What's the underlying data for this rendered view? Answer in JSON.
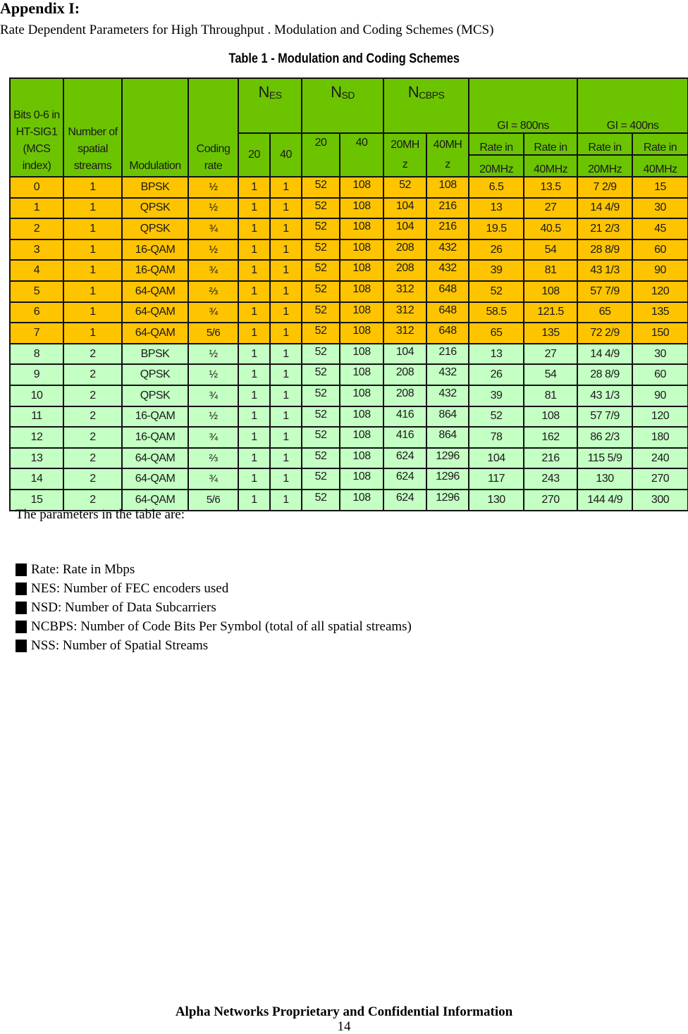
{
  "document": {
    "appendix_title": "Appendix I:",
    "subtitle": "Rate Dependent Parameters for High Throughput . Modulation and Coding Schemes (MCS)",
    "table_caption": "Table 1 - Modulation and Coding Schemes"
  },
  "colors": {
    "header_green": "#6cc400",
    "one_stream_orange": "#ffc400",
    "two_stream_green": "#c4ffc4"
  },
  "table": {
    "headers": {
      "mcs_index": "Bits 0-6 in HT-SIG1 (MCS index)",
      "spatial_streams": "Number of spatial streams",
      "modulation": "Modulation",
      "coding_rate": "Coding rate",
      "nes": {
        "base": "N",
        "sub": "ES",
        "col20": "20",
        "col40": "40"
      },
      "nsd": {
        "base": "N",
        "sub": "SD",
        "col20": "20",
        "col40": "40"
      },
      "ncbps": {
        "base": "N",
        "sub": "CBPS",
        "col20": "20MHz",
        "col40": "40MHz"
      },
      "gi800": "GI = 800ns",
      "gi400": "GI = 400ns",
      "rate_in": "Rate in",
      "mhz20": "20MHz",
      "mhz40": "40MHz"
    },
    "rows": [
      {
        "mcs": "0",
        "nss": "1",
        "mod": "BPSK",
        "rate": "½",
        "nes20": "1",
        "nes40": "1",
        "nsd20": "52",
        "nsd40": "108",
        "ncbps20": "52",
        "ncbps40": "108",
        "gi800_20": "6.5",
        "gi800_40": "13.5",
        "gi400_20": "7 2/9",
        "gi400_40": "15"
      },
      {
        "mcs": "1",
        "nss": "1",
        "mod": "QPSK",
        "rate": "½",
        "nes20": "1",
        "nes40": "1",
        "nsd20": "52",
        "nsd40": "108",
        "ncbps20": "104",
        "ncbps40": "216",
        "gi800_20": "13",
        "gi800_40": "27",
        "gi400_20": "14 4/9",
        "gi400_40": "30"
      },
      {
        "mcs": "2",
        "nss": "1",
        "mod": "QPSK",
        "rate": "¾",
        "nes20": "1",
        "nes40": "1",
        "nsd20": "52",
        "nsd40": "108",
        "ncbps20": "104",
        "ncbps40": "216",
        "gi800_20": "19.5",
        "gi800_40": "40.5",
        "gi400_20": "21 2/3",
        "gi400_40": "45"
      },
      {
        "mcs": "3",
        "nss": "1",
        "mod": "16-QAM",
        "rate": "½",
        "nes20": "1",
        "nes40": "1",
        "nsd20": "52",
        "nsd40": "108",
        "ncbps20": "208",
        "ncbps40": "432",
        "gi800_20": "26",
        "gi800_40": "54",
        "gi400_20": "28 8/9",
        "gi400_40": "60"
      },
      {
        "mcs": "4",
        "nss": "1",
        "mod": "16-QAM",
        "rate": "¾",
        "nes20": "1",
        "nes40": "1",
        "nsd20": "52",
        "nsd40": "108",
        "ncbps20": "208",
        "ncbps40": "432",
        "gi800_20": "39",
        "gi800_40": "81",
        "gi400_20": "43 1/3",
        "gi400_40": "90"
      },
      {
        "mcs": "5",
        "nss": "1",
        "mod": "64-QAM",
        "rate": "⅔",
        "nes20": "1",
        "nes40": "1",
        "nsd20": "52",
        "nsd40": "108",
        "ncbps20": "312",
        "ncbps40": "648",
        "gi800_20": "52",
        "gi800_40": "108",
        "gi400_20": "57 7/9",
        "gi400_40": "120"
      },
      {
        "mcs": "6",
        "nss": "1",
        "mod": "64-QAM",
        "rate": "¾",
        "nes20": "1",
        "nes40": "1",
        "nsd20": "52",
        "nsd40": "108",
        "ncbps20": "312",
        "ncbps40": "648",
        "gi800_20": "58.5",
        "gi800_40": "121.5",
        "gi400_20": "65",
        "gi400_40": "135"
      },
      {
        "mcs": "7",
        "nss": "1",
        "mod": "64-QAM",
        "rate": "5/6",
        "nes20": "1",
        "nes40": "1",
        "nsd20": "52",
        "nsd40": "108",
        "ncbps20": "312",
        "ncbps40": "648",
        "gi800_20": "65",
        "gi800_40": "135",
        "gi400_20": "72 2/9",
        "gi400_40": "150"
      },
      {
        "mcs": "8",
        "nss": "2",
        "mod": "BPSK",
        "rate": "½",
        "nes20": "1",
        "nes40": "1",
        "nsd20": "52",
        "nsd40": "108",
        "ncbps20": "104",
        "ncbps40": "216",
        "gi800_20": "13",
        "gi800_40": "27",
        "gi400_20": "14 4/9",
        "gi400_40": "30"
      },
      {
        "mcs": "9",
        "nss": "2",
        "mod": "QPSK",
        "rate": "½",
        "nes20": "1",
        "nes40": "1",
        "nsd20": "52",
        "nsd40": "108",
        "ncbps20": "208",
        "ncbps40": "432",
        "gi800_20": "26",
        "gi800_40": "54",
        "gi400_20": "28 8/9",
        "gi400_40": "60"
      },
      {
        "mcs": "10",
        "nss": "2",
        "mod": "QPSK",
        "rate": "¾",
        "nes20": "1",
        "nes40": "1",
        "nsd20": "52",
        "nsd40": "108",
        "ncbps20": "208",
        "ncbps40": "432",
        "gi800_20": "39",
        "gi800_40": "81",
        "gi400_20": "43 1/3",
        "gi400_40": "90"
      },
      {
        "mcs": "11",
        "nss": "2",
        "mod": "16-QAM",
        "rate": "½",
        "nes20": "1",
        "nes40": "1",
        "nsd20": "52",
        "nsd40": "108",
        "ncbps20": "416",
        "ncbps40": "864",
        "gi800_20": "52",
        "gi800_40": "108",
        "gi400_20": "57 7/9",
        "gi400_40": "120"
      },
      {
        "mcs": "12",
        "nss": "2",
        "mod": "16-QAM",
        "rate": "¾",
        "nes20": "1",
        "nes40": "1",
        "nsd20": "52",
        "nsd40": "108",
        "ncbps20": "416",
        "ncbps40": "864",
        "gi800_20": "78",
        "gi800_40": "162",
        "gi400_20": "86 2/3",
        "gi400_40": "180"
      },
      {
        "mcs": "13",
        "nss": "2",
        "mod": "64-QAM",
        "rate": "⅔",
        "nes20": "1",
        "nes40": "1",
        "nsd20": "52",
        "nsd40": "108",
        "ncbps20": "624",
        "ncbps40": "1296",
        "gi800_20": "104",
        "gi800_40": "216",
        "gi400_20": "115 5/9",
        "gi400_40": "240"
      },
      {
        "mcs": "14",
        "nss": "2",
        "mod": "64-QAM",
        "rate": "¾",
        "nes20": "1",
        "nes40": "1",
        "nsd20": "52",
        "nsd40": "108",
        "ncbps20": "624",
        "ncbps40": "1296",
        "gi800_20": "117",
        "gi800_40": "243",
        "gi400_20": "130",
        "gi400_40": "270"
      },
      {
        "mcs": "15",
        "nss": "2",
        "mod": "64-QAM",
        "rate": "5/6",
        "nes20": "1",
        "nes40": "1",
        "nsd20": "52",
        "nsd40": "108",
        "ncbps20": "624",
        "ncbps40": "1296",
        "gi800_20": "130",
        "gi800_40": "270",
        "gi400_20": "144 4/9",
        "gi400_40": "300"
      }
    ]
  },
  "parameters": {
    "intro": "The parameters in the table are:",
    "items": [
      "Rate: Rate in Mbps",
      "NES: Number of FEC encoders used",
      "NSD: Number of Data Subcarriers",
      "NCBPS: Number of Code Bits Per Symbol (total of all spatial streams)",
      "NSS: Number of  Spatial Streams"
    ]
  },
  "footer": {
    "text": "Alpha Networks Proprietary and Confidential Information",
    "page_number": "14"
  }
}
